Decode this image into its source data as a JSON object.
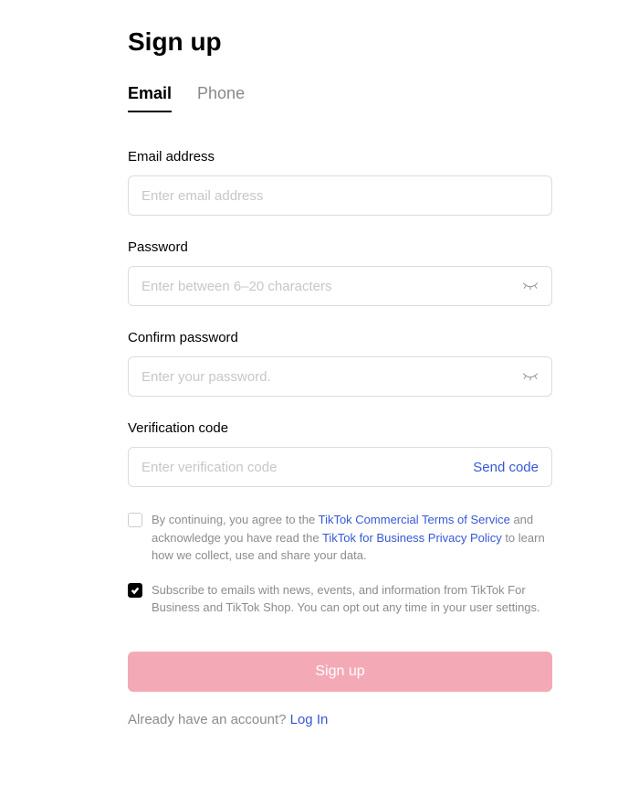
{
  "title": "Sign up",
  "tabs": {
    "email": "Email",
    "phone": "Phone"
  },
  "fields": {
    "email": {
      "label": "Email address",
      "placeholder": "Enter email address"
    },
    "password": {
      "label": "Password",
      "placeholder": "Enter between 6–20 characters"
    },
    "confirm": {
      "label": "Confirm password",
      "placeholder": "Enter your password."
    },
    "code": {
      "label": "Verification code",
      "placeholder": "Enter verification code",
      "send_label": "Send code"
    }
  },
  "terms": {
    "part1": "By continuing, you agree to the ",
    "link1": "TikTok Commercial Terms of Service",
    "part2": " and acknowledge you have read the ",
    "link2": "TikTok for Business Privacy Policy",
    "part3": " to learn how we collect, use and share your data."
  },
  "subscribe": {
    "text": "Subscribe to emails with news, events, and information from TikTok For Business and TikTok Shop. You can opt out any time in your user settings."
  },
  "submit_label": "Sign up",
  "login": {
    "prompt": "Already have an account? ",
    "link": "Log In"
  }
}
